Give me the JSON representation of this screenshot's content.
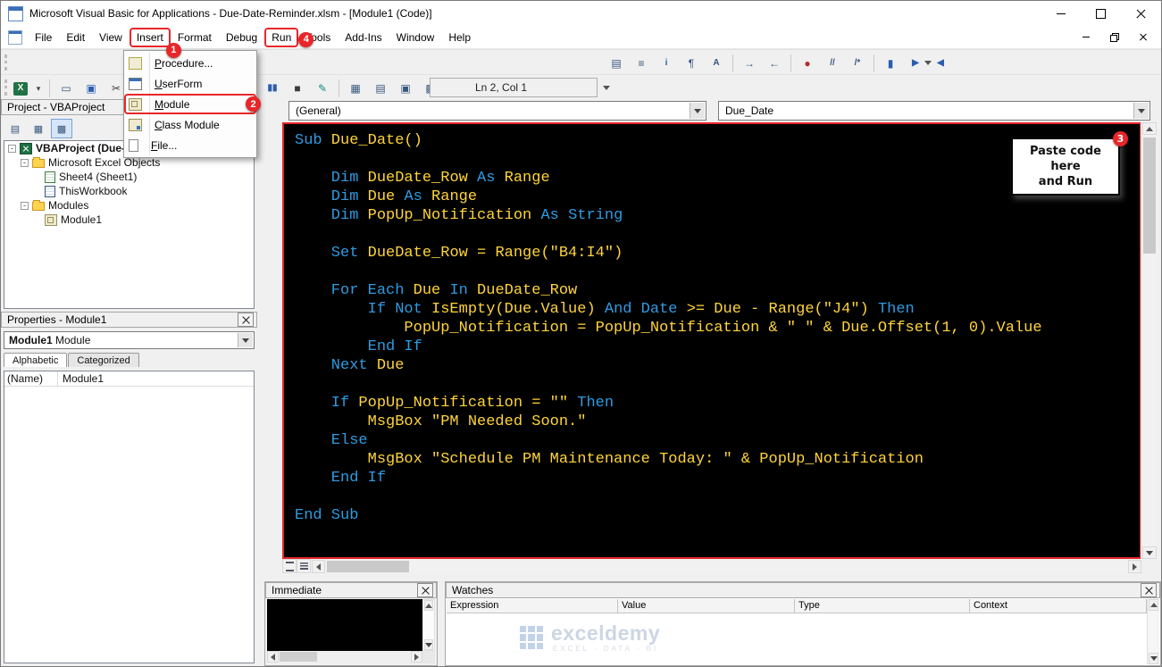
{
  "window": {
    "title": "Microsoft Visual Basic for Applications - Due-Date-Reminder.xlsm - [Module1 (Code)]"
  },
  "menu": {
    "items": [
      {
        "label": "File"
      },
      {
        "label": "Edit"
      },
      {
        "label": "View"
      },
      {
        "label": "Insert",
        "highlight": true,
        "badge": "1",
        "badge_pos": "pos-br"
      },
      {
        "label": "Format"
      },
      {
        "label": "Debug"
      },
      {
        "label": "Run",
        "highlight": true,
        "badge": "4",
        "badge_pos": "pos-r"
      },
      {
        "label": "Tools"
      },
      {
        "label": "Add-Ins"
      },
      {
        "label": "Window"
      },
      {
        "label": "Help"
      }
    ]
  },
  "insert_menu": {
    "items": [
      {
        "label": "Procedure...",
        "accel": 0,
        "icon": "procedure-icon"
      },
      {
        "label": "UserForm",
        "accel": 0,
        "icon": "userform-icon"
      },
      {
        "label": "Module",
        "accel": 0,
        "icon": "module-icon",
        "highlight": true,
        "badge": "2"
      },
      {
        "label": "Class Module",
        "accel": 0,
        "icon": "class-module-icon"
      },
      {
        "label": "File...",
        "accel": 0,
        "icon": "file-icon"
      }
    ]
  },
  "toolbars": {
    "position": "Ln 2, Col 1",
    "edit": [
      {
        "name": "list-properties-button",
        "glyph": "▤"
      },
      {
        "name": "list-constants-button",
        "glyph": "≡"
      },
      {
        "name": "quick-info-button",
        "glyph": "i",
        "cls": "small blue"
      },
      {
        "name": "parameter-info-button",
        "glyph": "¶"
      },
      {
        "name": "complete-word-button",
        "glyph": "A",
        "cls": "small"
      },
      {
        "sep": true
      },
      {
        "name": "indent-button",
        "glyph": "→"
      },
      {
        "name": "outdent-button",
        "glyph": "←"
      },
      {
        "sep": true
      },
      {
        "name": "toggle-breakpoint-button",
        "glyph": "●",
        "cls": "red"
      },
      {
        "name": "comment-block-button",
        "glyph": "//",
        "cls": "small"
      },
      {
        "name": "uncomment-block-button",
        "glyph": "/*",
        "cls": "small"
      },
      {
        "sep": true
      },
      {
        "name": "toggle-bookmark-button",
        "glyph": "▮",
        "cls": "blue"
      },
      {
        "name": "next-bookmark-button",
        "glyph": "▶",
        "cls": "small blue"
      },
      {
        "name": "previous-bookmark-button",
        "glyph": "◀",
        "cls": "small blue"
      }
    ],
    "standard_left": [
      {
        "name": "view-microsoft-excel-button",
        "glyph": "X",
        "cls": "excel"
      },
      {
        "name": "view-excel-dropdown",
        "glyph": "▾",
        "cls": "dd"
      },
      {
        "sep": true
      },
      {
        "name": "insert-userform-button",
        "glyph": "▭"
      },
      {
        "name": "save-button",
        "glyph": "▣",
        "cls": "blue"
      },
      {
        "name": "cut-button",
        "glyph": "✂",
        "cls": "dark"
      }
    ],
    "standard_right": [
      {
        "name": "break-button",
        "glyph": "▮▮",
        "cls": "small blue"
      },
      {
        "name": "reset-button",
        "glyph": "■",
        "cls": "dark"
      },
      {
        "name": "design-mode-button",
        "glyph": "✎",
        "cls": "teal"
      },
      {
        "sep": true
      },
      {
        "name": "project-explorer-button",
        "glyph": "▦"
      },
      {
        "name": "properties-window-button",
        "glyph": "▤"
      },
      {
        "name": "object-browser-button",
        "glyph": "▣"
      },
      {
        "name": "toolbox-button",
        "glyph": "▩"
      },
      {
        "sep": true
      },
      {
        "name": "help-button",
        "glyph": "?",
        "cls": "help"
      }
    ]
  },
  "project": {
    "title": "Project - VBAProject",
    "toolbar": [
      {
        "name": "view-code-button",
        "glyph": "▤"
      },
      {
        "name": "view-object-button",
        "glyph": "▦"
      },
      {
        "name": "toggle-folders-button",
        "glyph": "▩",
        "pressed": true
      }
    ],
    "tree": [
      {
        "label": "VBAProject (Due-Date-Reminder.xlsm)",
        "level": 0,
        "bold": true,
        "expander": "-",
        "icon": "excel-icon"
      },
      {
        "label": "Microsoft Excel Objects",
        "level": 1,
        "expander": "-",
        "icon": "folder-icon"
      },
      {
        "label": "Sheet4 (Sheet1)",
        "level": 2,
        "icon": "sheet-icon"
      },
      {
        "label": "ThisWorkbook",
        "level": 2,
        "icon": "workbook-icon"
      },
      {
        "label": "Modules",
        "level": 1,
        "expander": "-",
        "icon": "folder-icon"
      },
      {
        "label": "Module1",
        "level": 2,
        "icon": "module-file-icon"
      }
    ]
  },
  "properties": {
    "title": "Properties - Module1",
    "object_name": "Module1",
    "object_type": "Module",
    "tabs": [
      {
        "label": "Alphabetic",
        "active": true
      },
      {
        "label": "Categorized"
      }
    ],
    "rows": [
      {
        "name": "(Name)",
        "value": "Module1"
      }
    ]
  },
  "code": {
    "object_dropdown": "(General)",
    "procedure_dropdown": "Due_Date",
    "colors": {
      "keyword": "#2f9be1",
      "normal": "#ffd43a",
      "background": "#000000"
    },
    "lines": [
      [
        [
          "k",
          "Sub"
        ],
        [
          "n",
          " Due_Date()"
        ]
      ],
      [],
      [
        [
          "k",
          "    Dim"
        ],
        [
          "n",
          " DueDate_Row "
        ],
        [
          "k",
          "As"
        ],
        [
          "n",
          " Range"
        ]
      ],
      [
        [
          "k",
          "    Dim"
        ],
        [
          "n",
          " Due "
        ],
        [
          "k",
          "As"
        ],
        [
          "n",
          " Range"
        ]
      ],
      [
        [
          "k",
          "    Dim"
        ],
        [
          "n",
          " PopUp_Notification "
        ],
        [
          "k",
          "As String"
        ]
      ],
      [],
      [
        [
          "k",
          "    Set"
        ],
        [
          "n",
          " DueDate_Row = Range(\"B4:I4\")"
        ]
      ],
      [],
      [
        [
          "k",
          "    For Each"
        ],
        [
          "n",
          " Due "
        ],
        [
          "k",
          "In"
        ],
        [
          "n",
          " DueDate_Row"
        ]
      ],
      [
        [
          "k",
          "        If Not"
        ],
        [
          "n",
          " IsEmpty(Due.Value) "
        ],
        [
          "k",
          "And Date"
        ],
        [
          "n",
          " >= Due - Range(\"J4\") "
        ],
        [
          "k",
          "Then"
        ]
      ],
      [
        [
          "n",
          "            PopUp_Notification = PopUp_Notification & \" \" & Due.Offset(1, 0).Value"
        ]
      ],
      [
        [
          "k",
          "        End If"
        ]
      ],
      [
        [
          "k",
          "    Next"
        ],
        [
          "n",
          " Due"
        ]
      ],
      [],
      [
        [
          "k",
          "    If"
        ],
        [
          "n",
          " PopUp_Notification = \"\" "
        ],
        [
          "k",
          "Then"
        ]
      ],
      [
        [
          "n",
          "        MsgBox \"PM Needed Soon.\""
        ]
      ],
      [
        [
          "k",
          "    Else"
        ]
      ],
      [
        [
          "n",
          "        MsgBox \"Schedule PM Maintenance Today: \" & PopUp_Notification"
        ]
      ],
      [
        [
          "k",
          "    End If"
        ]
      ],
      [],
      [
        [
          "k",
          "End Sub"
        ]
      ]
    ]
  },
  "annotations": {
    "color": "#e8262a",
    "note_line1": "Paste code here",
    "note_line2": "and Run",
    "badges": {
      "insert": "1",
      "module": "2",
      "note": "3",
      "run": "4"
    }
  },
  "immediate": {
    "title": "Immediate"
  },
  "watches": {
    "title": "Watches",
    "columns": [
      "Expression",
      "Value",
      "Type",
      "Context"
    ]
  },
  "watermark": {
    "name": "exceldemy",
    "tagline": "EXCEL · DATA · BI"
  }
}
